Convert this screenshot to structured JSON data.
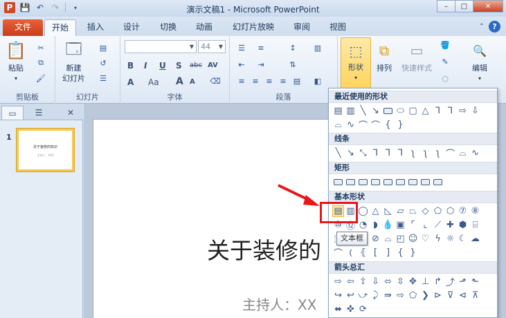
{
  "window": {
    "title": "演示文稿1 - Microsoft PowerPoint",
    "min": "–",
    "max": "□",
    "close": "✕"
  },
  "tabs": [
    "文件",
    "开始",
    "插入",
    "设计",
    "切换",
    "动画",
    "幻灯片放映",
    "审阅",
    "视图"
  ],
  "ribbon": {
    "clipboard": {
      "paste": "粘贴",
      "label": "剪贴板"
    },
    "slides": {
      "new_slide": "新建",
      "new_slide2": "幻灯片",
      "label": "幻灯片"
    },
    "font": {
      "size": "44",
      "label": "字体",
      "bold": "B",
      "italic": "I",
      "underline": "U",
      "shadow": "S",
      "strike": "abc",
      "spacing": "AV",
      "case": "Aa",
      "grow": "A",
      "shrink": "A",
      "color": "A"
    },
    "paragraph": {
      "label": "段落"
    },
    "drawing": {
      "shapes": "形状",
      "arrange": "排列",
      "quick_styles": "快速样式"
    },
    "editing": {
      "label": "编辑"
    }
  },
  "left_pane": {
    "slide_number": "1",
    "thumb_title": "关于装修的知识",
    "thumb_sub": "主持人：XXX"
  },
  "slide": {
    "title": "关于装修的",
    "subtitle": "主持人：XX"
  },
  "gallery": {
    "recent": "最近使用的形状",
    "lines": "线条",
    "rect": "矩形",
    "basic": "基本形状",
    "arrows": "箭头总汇"
  },
  "tooltip": "文本框",
  "colors": {
    "accent": "#e8151a",
    "file_tab": "#d64a22",
    "highlight": "#ffd35a"
  }
}
